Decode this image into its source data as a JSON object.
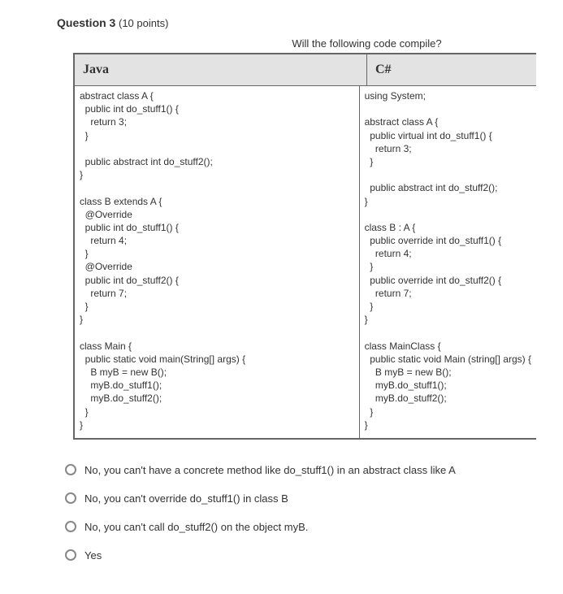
{
  "question": {
    "number_label": "Question 3",
    "points_label": "(10 points)",
    "prompt": "Will the following code compile?"
  },
  "table": {
    "headers": {
      "java": "Java",
      "csharp": "C#"
    },
    "code": {
      "java": "abstract class A {\n  public int do_stuff1() {\n    return 3;\n  }\n\n  public abstract int do_stuff2();\n}\n\nclass B extends A {\n  @Override\n  public int do_stuff1() {\n    return 4;\n  }\n  @Override\n  public int do_stuff2() {\n    return 7;\n  }\n}\n\nclass Main {\n  public static void main(String[] args) {\n    B myB = new B();\n    myB.do_stuff1();\n    myB.do_stuff2();\n  }\n}",
      "csharp": "using System;\n\nabstract class A {\n  public virtual int do_stuff1() {\n    return 3;\n  }\n\n  public abstract int do_stuff2();\n}\n\nclass B : A {\n  public override int do_stuff1() {\n    return 4;\n  }\n  public override int do_stuff2() {\n    return 7;\n  }\n}\n\nclass MainClass {\n  public static void Main (string[] args) {\n    B myB = new B();\n    myB.do_stuff1();\n    myB.do_stuff2();\n  }\n}"
    }
  },
  "options": [
    "No, you can't have a concrete method like do_stuff1() in an abstract class like A",
    "No, you can't override do_stuff1() in class B",
    "No, you can't call do_stuff2() on the object myB.",
    "Yes"
  ]
}
